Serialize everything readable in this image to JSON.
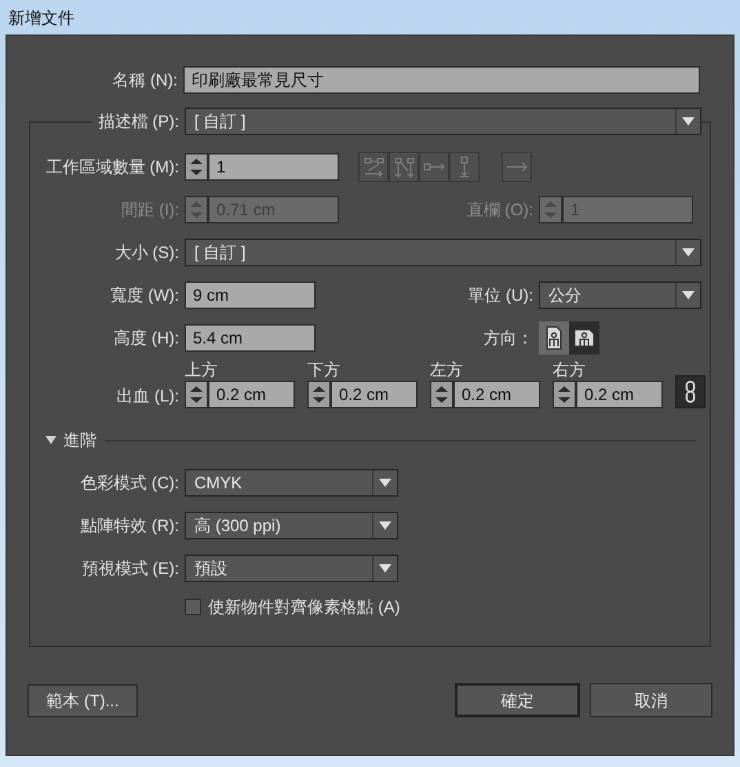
{
  "window": {
    "title": "新增文件"
  },
  "name": {
    "label": "名稱 (N):",
    "value": "印刷廠最常見尺寸"
  },
  "profile": {
    "label": "描述檔 (P):",
    "value": "[ 自訂 ]"
  },
  "artboards": {
    "label": "工作區域數量 (M):",
    "value": "1",
    "layouts": [
      {
        "kind": "grid-row"
      },
      {
        "kind": "grid-column"
      },
      {
        "kind": "row"
      },
      {
        "kind": "column"
      },
      {
        "kind": "direction"
      }
    ]
  },
  "spacing": {
    "label": "間距 (I):",
    "value": "0.71 cm",
    "disabled": true
  },
  "columns": {
    "label": "直欄 (O):",
    "value": "1",
    "disabled": true
  },
  "size": {
    "label": "大小 (S):",
    "value": "[ 自訂 ]"
  },
  "width": {
    "label": "寬度 (W):",
    "value": "9 cm"
  },
  "units": {
    "label": "單位 (U):",
    "value": "公分"
  },
  "height": {
    "label": "高度 (H):",
    "value": "5.4 cm"
  },
  "orientation": {
    "label": "方向：",
    "options": [
      {
        "kind": "portrait",
        "selected": false
      },
      {
        "kind": "landscape",
        "selected": true
      }
    ]
  },
  "bleed": {
    "label": "出血 (L):",
    "linked": true,
    "fields": [
      {
        "caption": "上方",
        "value": "0.2 cm"
      },
      {
        "caption": "下方",
        "value": "0.2 cm"
      },
      {
        "caption": "左方",
        "value": "0.2 cm"
      },
      {
        "caption": "右方",
        "value": "0.2 cm"
      }
    ]
  },
  "advanced": {
    "label": "進階",
    "expanded": true
  },
  "color_mode": {
    "label": "色彩模式 (C):",
    "value": "CMYK"
  },
  "raster_effects": {
    "label": "點陣特效 (R):",
    "value": "高 (300 ppi)"
  },
  "preview_mode": {
    "label": "預視模式 (E):",
    "value": "預設"
  },
  "align_pixel": {
    "label": "使新物件對齊像素格點 (A)",
    "checked": false
  },
  "buttons": {
    "templates": "範本 (T)...",
    "ok": "確定",
    "cancel": "取消"
  }
}
